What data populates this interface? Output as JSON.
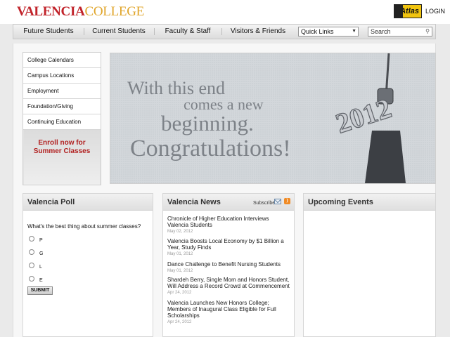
{
  "header": {
    "logo_part1": "VALENCIA",
    "logo_part2": "COLLEGE",
    "atlas_label": "Atlas",
    "login_label": "LOGIN"
  },
  "nav": {
    "items": [
      "Future Students",
      "Current Students",
      "Faculty & Staff",
      "Visitors & Friends"
    ],
    "quick_links": "Quick Links",
    "search_placeholder": "Search"
  },
  "sidebar": {
    "items": [
      "College Calendars",
      "Campus Locations",
      "Employment",
      "Foundation/Giving",
      "Continuing Education"
    ],
    "enroll_line1": "Enroll now for",
    "enroll_line2": "Summer Classes"
  },
  "banner": {
    "line1": "With this end",
    "line2": "comes a new",
    "line3": "beginning.",
    "line4": "Congratulations!",
    "year": "2012"
  },
  "poll": {
    "title": "Valencia Poll",
    "question": "What's the best thing about summer classes?",
    "options": [
      "P",
      "G",
      "L",
      "E"
    ],
    "submit_label": "SUBMIT"
  },
  "news": {
    "title": "Valencia News",
    "subscribe_label": "Subscribe",
    "items": [
      {
        "title": "Chronicle of Higher Education Interviews Valencia Students",
        "date": "May 02, 2012"
      },
      {
        "title": "Valencia Boosts Local Economy by $1 Billion a Year, Study Finds",
        "date": "May 01, 2012"
      },
      {
        "title": "Dance Challenge to Benefit Nursing Students",
        "date": "May 01, 2012"
      },
      {
        "title": "Shardeh Berry, Single Mom and Honors Student, Will Address a Record Crowd at Commencement",
        "date": "Apr 24, 2012"
      },
      {
        "title": "Valencia Launches New Honors College; Members of Inaugural Class Eligible for Full Scholarships",
        "date": "Apr 24, 2012"
      }
    ]
  },
  "events": {
    "title": "Upcoming Events"
  },
  "colors": {
    "brand_red": "#c1232a",
    "brand_gold": "#e0a52a",
    "enroll_red": "#b22222",
    "rss_orange": "#f08a24"
  },
  "icons": [
    "atlas-logo-icon",
    "chevron-down-icon",
    "search-icon",
    "mail-icon",
    "rss-icon"
  ]
}
